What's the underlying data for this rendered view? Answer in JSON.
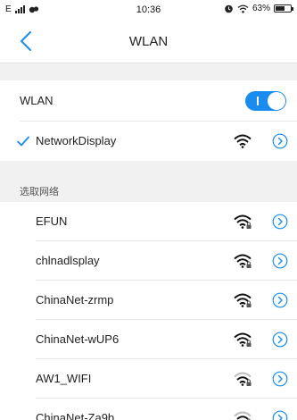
{
  "status": {
    "carrier": "E",
    "time": "10:36",
    "battery": "63%",
    "battery_level": 0.63,
    "signal_icon": "cell-signal-icon",
    "alarm_icon": "alarm-icon",
    "wifi_icon": "wifi-status-icon"
  },
  "nav": {
    "title": "WLAN",
    "back_icon": "chevron-left-icon"
  },
  "wlan_toggle": {
    "label": "WLAN",
    "on": true
  },
  "connected": {
    "name": "NetworkDisplay"
  },
  "section": {
    "title": "选取网络"
  },
  "networks": [
    {
      "name": "EFUN"
    },
    {
      "name": "chlnadlsplay"
    },
    {
      "name": "ChinaNet-zrmp"
    },
    {
      "name": "ChinaNet-wUP6"
    },
    {
      "name": "AW1_WIFI"
    },
    {
      "name": "ChinaNet-Za9b"
    }
  ],
  "colors": {
    "accent": "#1a8cf0",
    "section_bg": "#f1f1f1",
    "divider": "#e6e6e6"
  }
}
